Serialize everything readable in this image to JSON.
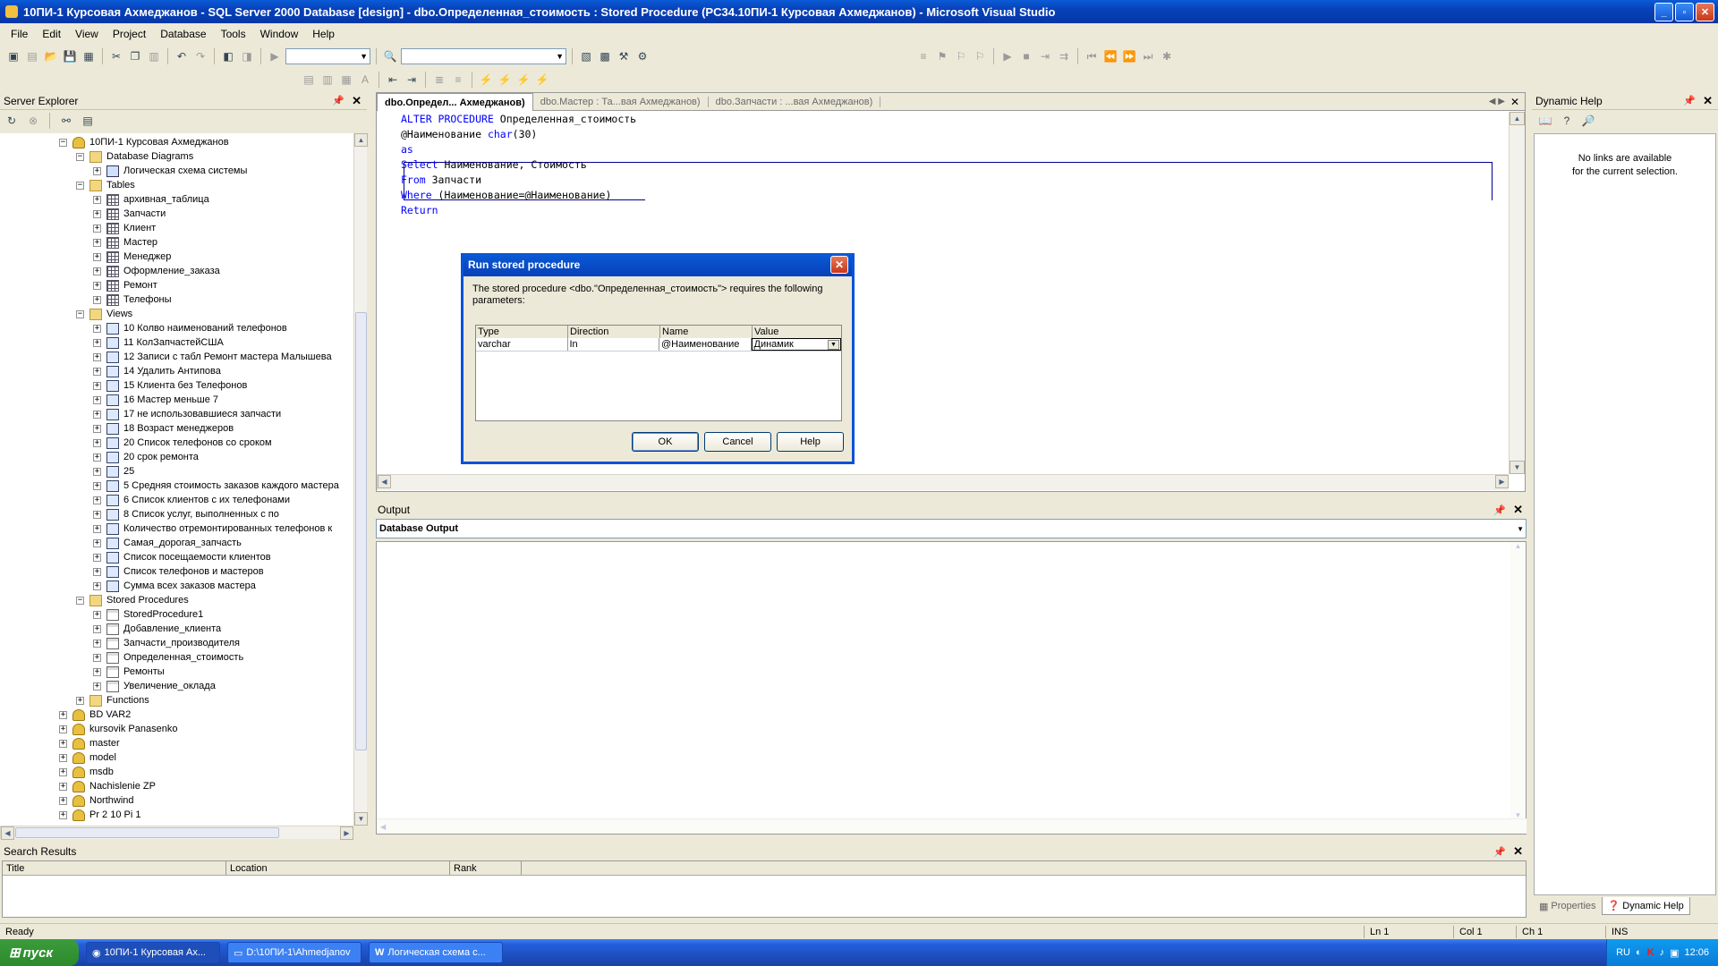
{
  "window": {
    "title": "10ПИ-1 Курсовая Ахмеджанов - SQL Server 2000 Database [design] - dbo.Определенная_стоимость : Stored Procedure (PC34.10ПИ-1 Курсовая Ахмеджанов) - Microsoft Visual Studio"
  },
  "menu": [
    "File",
    "Edit",
    "View",
    "Project",
    "Database",
    "Tools",
    "Window",
    "Help"
  ],
  "server_explorer": {
    "title": "Server Explorer",
    "db_root": "10ПИ-1 Курсовая Ахмеджанов",
    "diagrams_folder": "Database Diagrams",
    "diagrams": [
      "Логическая схема системы"
    ],
    "tables_folder": "Tables",
    "tables": [
      "архивная_таблица",
      "Запчасти",
      "Клиент",
      "Мастер",
      "Менеджер",
      "Оформление_заказа",
      "Ремонт",
      "Телефоны"
    ],
    "views_folder": "Views",
    "views": [
      "10 Колво наименований телефонов",
      "11 КолЗапчастейСША",
      "12 Записи с табл Ремонт мастера Малышева",
      "14 Удалить Антипова",
      "15 Клиента без Телефонов",
      "16 Мастер меньше 7",
      "17 не использовавшиеся запчасти",
      "18 Возраст менеджеров",
      "20 Список телефонов со сроком",
      "20 срок ремонта",
      "25",
      "5 Средняя стоимость заказов каждого мастера",
      "6 Список клиентов с их телефонами",
      "8 Список услуг, выполненных  с по",
      "Количество отремонтированных телефонов к",
      "Самая_дорогая_запчасть",
      "Список посещаемости клиентов",
      "Список телефонов и мастеров",
      "Сумма всех заказов мастера"
    ],
    "procs_folder": "Stored Procedures",
    "procs": [
      "StoredProcedure1",
      "Добавление_клиента",
      "Запчасти_производителя",
      "Определенная_стоимость",
      "Ремонты",
      "Увеличение_оклада"
    ],
    "functions_folder": "Functions",
    "other_dbs": [
      "BD VAR2",
      "kursovik Panasenko",
      "master",
      "model",
      "msdb",
      "Nachislenie ZP",
      "Northwind",
      "Pr 2 10 Pi 1"
    ]
  },
  "editor": {
    "tabs": [
      "dbo.Определ... Ахмеджанов)",
      "dbo.Мастер : Та...вая Ахмеджанов)",
      "dbo.Запчасти : ...вая Ахмеджанов)"
    ],
    "lines": [
      {
        "kw": "ALTER PROCEDURE",
        "rest": " Определенная_стоимость"
      },
      {
        "kw": "",
        "rest": "@Наименование ",
        "kw2": "char",
        "rest2": "(30)"
      },
      {
        "kw": "as",
        "rest": ""
      },
      {
        "kw": "Select",
        "rest": " Наименование, Стоимость"
      },
      {
        "kw": "From",
        "rest": " Запчасти"
      },
      {
        "kw": "Where",
        "rest": " (Наименование=@Наименование)"
      },
      {
        "kw": "Return",
        "rest": ""
      }
    ]
  },
  "dialog": {
    "title": "Run stored procedure",
    "message": "The stored procedure <dbo.\"Определенная_стоимость\"> requires the following parameters:",
    "columns": [
      "Type",
      "Direction",
      "Name",
      "Value"
    ],
    "row": {
      "type": "varchar",
      "direction": "In",
      "name": "@Наименование",
      "value": "Динамик"
    },
    "ok": "OK",
    "cancel": "Cancel",
    "help": "Help"
  },
  "output": {
    "title": "Output",
    "selector": "Database Output"
  },
  "dynamic_help": {
    "title": "Dynamic Help",
    "message_line1": "No links are available",
    "message_line2": "for the current selection.",
    "tab_properties": "Properties",
    "tab_dynamic_help": "Dynamic Help"
  },
  "search_results": {
    "title": "Search Results",
    "columns": [
      "Title",
      "Location",
      "Rank"
    ]
  },
  "status": {
    "text": "Ready",
    "ln": "Ln 1",
    "col": "Col 1",
    "ch": "Ch 1",
    "ins": "INS"
  },
  "taskbar": {
    "start": "пуск",
    "tasks": [
      "10ПИ-1 Курсовая Ах...",
      "D:\\10ПИ-1\\Ahmedjanov",
      "Логическая схема с..."
    ],
    "lang": "RU",
    "clock": "12:06"
  }
}
